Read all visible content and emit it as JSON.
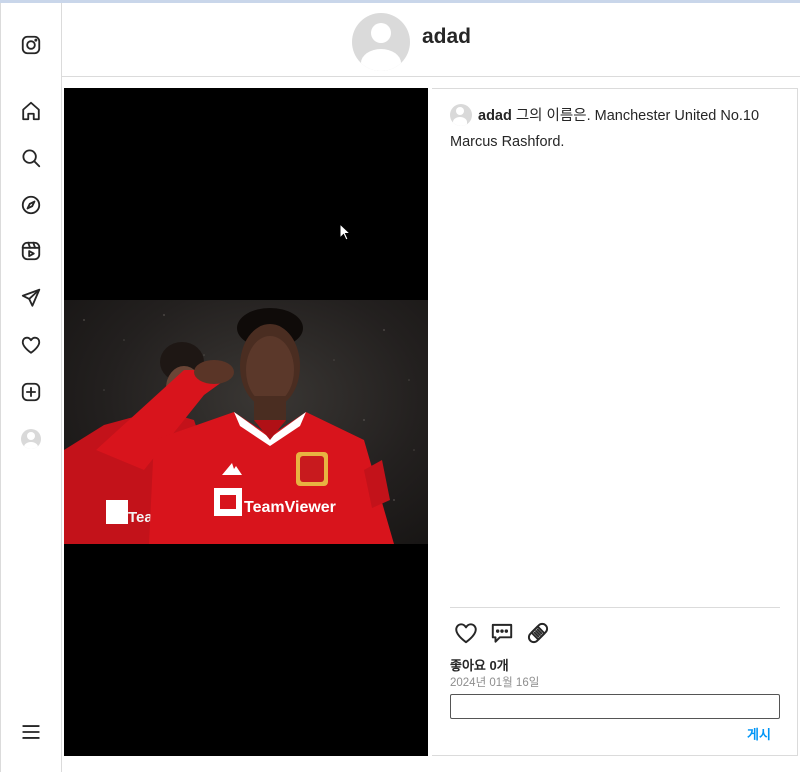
{
  "sidebar": {
    "items": [
      {
        "name": "instagram-icon"
      },
      {
        "name": "home-icon"
      },
      {
        "name": "search-icon"
      },
      {
        "name": "explore-icon"
      },
      {
        "name": "reels-icon"
      },
      {
        "name": "messages-icon"
      },
      {
        "name": "notifications-icon"
      },
      {
        "name": "create-icon"
      },
      {
        "name": "profile-avatar-icon"
      },
      {
        "name": "menu-icon"
      }
    ]
  },
  "header": {
    "username": "adad"
  },
  "post": {
    "caption_user": "adad",
    "caption_text": "그의 이름은. Manchester United No.10 Marcus Rashford.",
    "likes_text": "좋아요 0개",
    "date_text": "2024년 01월 16일",
    "comment_placeholder": "",
    "submit_label": "게시",
    "photo_sponsor_text": "TeamViewer",
    "photo_sponsor_text_left": "TeamViewer",
    "icons": [
      "heart-icon",
      "comment-icon",
      "bandage-icon"
    ]
  },
  "colors": {
    "accent": "#0095f6",
    "border": "#dbdbdb",
    "jersey_red": "#d8141c",
    "muted": "#8e8e8e"
  }
}
